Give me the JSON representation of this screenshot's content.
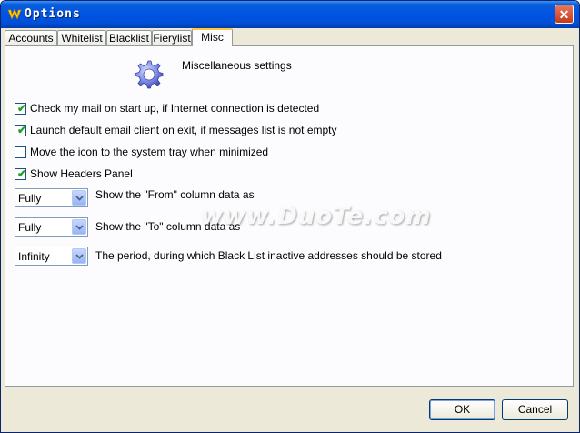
{
  "window": {
    "title": "Options",
    "close_label": "✕"
  },
  "tabs": [
    {
      "label": "Accounts"
    },
    {
      "label": "Whitelist"
    },
    {
      "label": "Blacklist"
    },
    {
      "label": "Fierylist"
    },
    {
      "label": "Misc"
    }
  ],
  "active_tab": "Misc",
  "misc": {
    "heading": "Miscellaneous settings",
    "checkboxes": [
      {
        "label": "Check my mail on start up, if Internet connection is detected",
        "checked": true
      },
      {
        "label": "Launch default email client on exit, if messages list is not empty",
        "checked": true
      },
      {
        "label": "Move the icon to the system tray when minimized",
        "checked": false
      },
      {
        "label": "Show Headers Panel",
        "checked": true
      }
    ],
    "combos": [
      {
        "value": "Fully",
        "label": "Show the \"From\" column data as"
      },
      {
        "value": "Fully",
        "label": "Show the \"To\" column data as"
      },
      {
        "value": "Infinity",
        "label": "The period, during which Black List inactive addresses should be stored"
      }
    ]
  },
  "watermark": "www.DuoTe.com",
  "buttons": {
    "ok": "OK",
    "cancel": "Cancel"
  },
  "colors": {
    "titlebar": "#0054e3",
    "tab_highlight": "#ffc83c",
    "checkmark": "#21a121"
  }
}
